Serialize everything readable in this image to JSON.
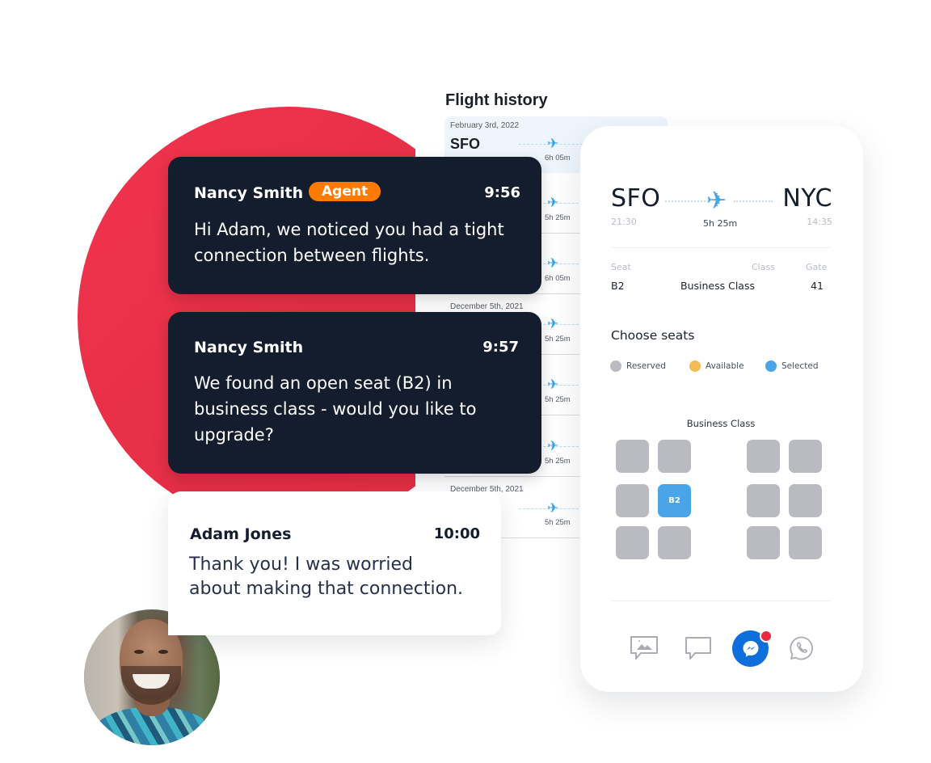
{
  "flight_history": {
    "title": "Flight history",
    "rows": [
      {
        "date": "February 3rd, 2022",
        "origin": "SFO",
        "duration": "6h 05m"
      },
      {
        "date": "",
        "origin": "",
        "duration": "5h 25m"
      },
      {
        "date": "",
        "origin": "",
        "duration": "6h 05m"
      },
      {
        "date": "December 5th, 2021",
        "origin": "",
        "duration": "5h 25m"
      },
      {
        "date": "",
        "origin": "",
        "duration": "5h 25m"
      },
      {
        "date": "",
        "origin": "",
        "duration": "5h 25m"
      },
      {
        "date": "December 5th, 2021",
        "origin": "",
        "duration": "5h 25m"
      }
    ]
  },
  "chat": {
    "messages": [
      {
        "sender": "Nancy Smith",
        "badge": "Agent",
        "time": "9:56",
        "lines": [
          "Hi Adam, we noticed you had a tight",
          "connection between flights."
        ]
      },
      {
        "sender": "Nancy Smith",
        "badge": "",
        "time": "9:57",
        "lines": [
          "We found an open seat (B2) in",
          "business class - would you like to",
          "upgrade?"
        ]
      },
      {
        "sender": "Adam Jones",
        "badge": "",
        "time": "10:00",
        "lines": [
          "Thank you! I was worried",
          "about making that connection."
        ]
      }
    ],
    "avatar_alt": "Adam Jones"
  },
  "booking": {
    "origin": "SFO",
    "destination": "NYC",
    "depart_time": "21:30",
    "arrive_time": "14:35",
    "duration": "5h 25m",
    "labels": {
      "seat": "Seat",
      "class": "Class",
      "gate": "Gate"
    },
    "seat": "B2",
    "class": "Business Class",
    "gate": "41",
    "choose_seats": "Choose seats",
    "legend": [
      {
        "label": "Reserved",
        "color": "#b9bbc0"
      },
      {
        "label": "Available",
        "color": "#f2bb55"
      },
      {
        "label": "Selected",
        "color": "#4aa5e8"
      }
    ],
    "cabin_label": "Business Class",
    "seat_map": [
      [
        {
          "label": "",
          "state": "reserved"
        },
        {
          "label": "",
          "state": "reserved"
        },
        {
          "label": "",
          "state": "reserved"
        },
        {
          "label": "",
          "state": "reserved"
        }
      ],
      [
        {
          "label": "",
          "state": "reserved"
        },
        {
          "label": "B2",
          "state": "selected"
        },
        {
          "label": "",
          "state": "reserved"
        },
        {
          "label": "",
          "state": "reserved"
        }
      ],
      [
        {
          "label": "",
          "state": "reserved"
        },
        {
          "label": "",
          "state": "reserved"
        },
        {
          "label": "",
          "state": "reserved"
        },
        {
          "label": "",
          "state": "reserved"
        }
      ]
    ],
    "channels": [
      {
        "name": "sms-mms",
        "active": false
      },
      {
        "name": "chat",
        "active": false
      },
      {
        "name": "messenger",
        "active": true,
        "notification": true
      },
      {
        "name": "whatsapp",
        "active": false
      }
    ],
    "colors": {
      "accent": "#0e6fdc",
      "notification": "#e8293f",
      "badge": "#ff7a00",
      "brand_red": "#f2334d"
    }
  }
}
